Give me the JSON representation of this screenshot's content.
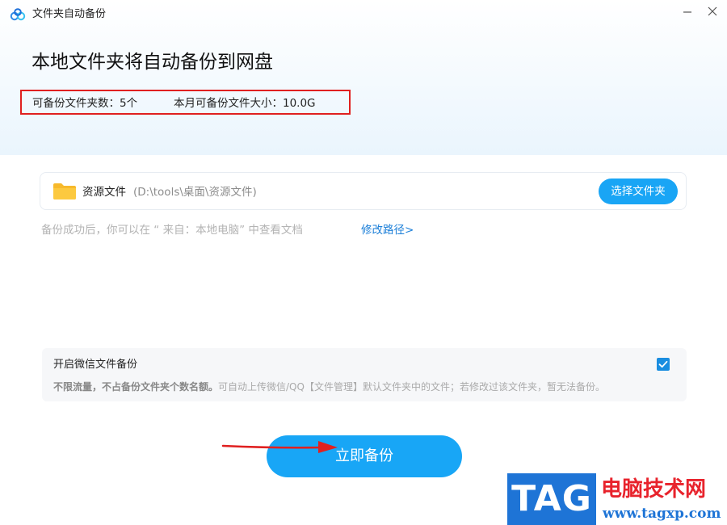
{
  "window": {
    "title": "文件夹自动备份",
    "icons": {
      "logo": "baidu-netdisk-logo-icon",
      "minimize": "minimize-icon",
      "close": "close-icon"
    }
  },
  "header": {
    "headline": "本地文件夹将自动备份到网盘",
    "stats": {
      "folder_count": "可备份文件夹数：5个",
      "monthly_size": "本月可备份文件大小：10.0G"
    }
  },
  "folder": {
    "icon": "folder-icon",
    "name": "资源文件",
    "path": "(D:\\tools\\桌面\\资源文件)",
    "select_button": "选择文件夹"
  },
  "hint": {
    "text": "备份成功后，你可以在 “ 来自：本地电脑” 中查看文档",
    "modify_link": "修改路径>"
  },
  "wechat": {
    "title": "开启微信文件备份",
    "checked": true,
    "desc_bold": "不限流量，不占备份文件夹个数名额。",
    "desc_rest": "可自动上传微信/QQ【文件管理】默认文件夹中的文件；若修改过该文件夹，暂无法备份。"
  },
  "actions": {
    "backup_now": "立即备份"
  },
  "watermark": {
    "tag": "TAG",
    "site_name": "电脑技术网",
    "url": "www.tagxp.com"
  },
  "colors": {
    "accent": "#18a6f6",
    "link": "#1a7ed8",
    "highlight_border": "#e02020",
    "annotation_arrow": "#e02020"
  }
}
